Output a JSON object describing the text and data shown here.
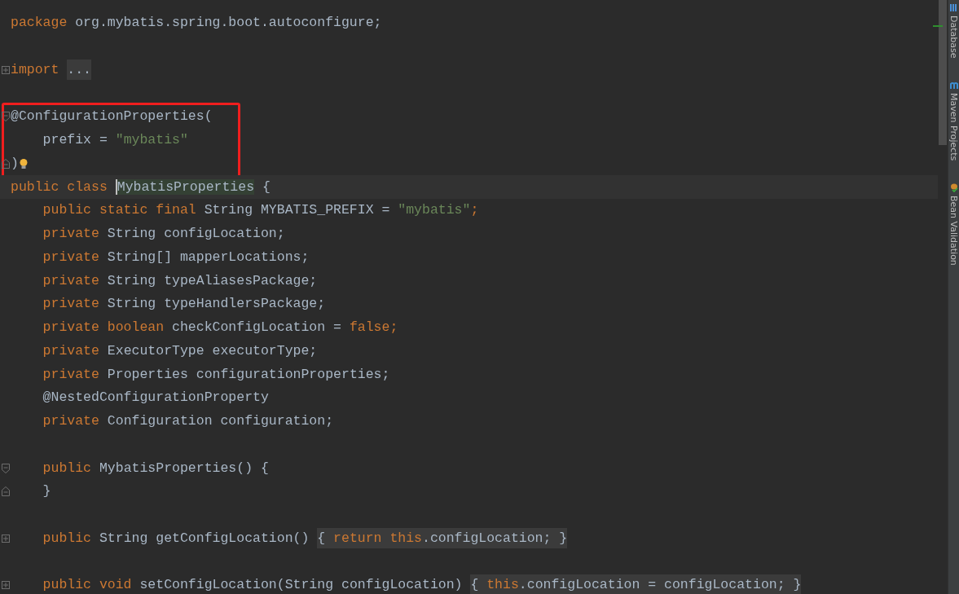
{
  "editor": {
    "lines": [
      {
        "tokens": [
          {
            "kind": "keyword",
            "text": "package"
          },
          {
            "kind": "plain",
            "text": " org.mybatis.spring.boot.autoconfigure;"
          }
        ]
      },
      {
        "blank_line_before": true,
        "gutter": {
          "kind": "collapsed"
        },
        "tokens": [
          {
            "kind": "keyword",
            "text": "import "
          },
          {
            "kind": "fold",
            "tokens": [
              {
                "kind": "plain",
                "text": "..."
              }
            ]
          }
        ]
      },
      {
        "blank_line_before": true,
        "gutter": {
          "kind": "start"
        },
        "boxed": true,
        "tokens": [
          {
            "kind": "plain",
            "text": "@ConfigurationProperties("
          }
        ]
      },
      {
        "boxed": true,
        "tokens": [
          {
            "kind": "plain",
            "text": "    prefix = "
          },
          {
            "kind": "string",
            "text": "\"mybatis\""
          }
        ]
      },
      {
        "gutter": {
          "kind": "end"
        },
        "boxed": true,
        "bulb": true,
        "tokens": [
          {
            "kind": "plain",
            "text": ")"
          }
        ]
      },
      {
        "current": true,
        "tokens": [
          {
            "kind": "keyword",
            "text": "public class "
          },
          {
            "kind": "usage",
            "text": "MybatisProperties"
          },
          {
            "kind": "plain",
            "text": " {"
          }
        ]
      },
      {
        "tokens": [
          {
            "kind": "keyword",
            "text": "    public static final "
          },
          {
            "kind": "plain",
            "text": "String MYBATIS_PREFIX = "
          },
          {
            "kind": "string",
            "text": "\"mybatis\""
          },
          {
            "kind": "keyword",
            "text": ";"
          }
        ]
      },
      {
        "tokens": [
          {
            "kind": "keyword",
            "text": "    private "
          },
          {
            "kind": "plain",
            "text": "String configLocation;"
          }
        ]
      },
      {
        "tokens": [
          {
            "kind": "keyword",
            "text": "    private "
          },
          {
            "kind": "plain",
            "text": "String[] mapperLocations;"
          }
        ]
      },
      {
        "tokens": [
          {
            "kind": "keyword",
            "text": "    private "
          },
          {
            "kind": "plain",
            "text": "String typeAliasesPackage;"
          }
        ]
      },
      {
        "tokens": [
          {
            "kind": "keyword",
            "text": "    private "
          },
          {
            "kind": "plain",
            "text": "String typeHandlersPackage;"
          }
        ]
      },
      {
        "tokens": [
          {
            "kind": "keyword",
            "text": "    private boolean "
          },
          {
            "kind": "plain",
            "text": "checkConfigLocation = "
          },
          {
            "kind": "keyword",
            "text": "false;"
          }
        ]
      },
      {
        "tokens": [
          {
            "kind": "keyword",
            "text": "    private "
          },
          {
            "kind": "plain",
            "text": "ExecutorType executorType;"
          }
        ]
      },
      {
        "tokens": [
          {
            "kind": "keyword",
            "text": "    private "
          },
          {
            "kind": "plain",
            "text": "Properties configurationProperties;"
          }
        ]
      },
      {
        "tokens": [
          {
            "kind": "plain",
            "text": "    @NestedConfigurationProperty"
          }
        ]
      },
      {
        "tokens": [
          {
            "kind": "keyword",
            "text": "    private "
          },
          {
            "kind": "plain",
            "text": "Configuration configuration;"
          }
        ]
      },
      {
        "blank_line_before": true,
        "gutter": {
          "kind": "start"
        },
        "tokens": [
          {
            "kind": "keyword",
            "text": "    public "
          },
          {
            "kind": "plain",
            "text": "MybatisProperties() {"
          }
        ]
      },
      {
        "gutter": {
          "kind": "end"
        },
        "tokens": [
          {
            "kind": "plain",
            "text": "    }"
          }
        ]
      },
      {
        "blank_line_before": true,
        "gutter": {
          "kind": "collapsed"
        },
        "tokens": [
          {
            "kind": "keyword",
            "text": "    public "
          },
          {
            "kind": "plain",
            "text": "String getConfigLocation() "
          },
          {
            "kind": "fold",
            "tokens": [
              {
                "kind": "plain",
                "text": "{ "
              },
              {
                "kind": "keyword",
                "text": "return this"
              },
              {
                "kind": "plain",
                "text": ".configLocation; }"
              }
            ]
          }
        ]
      },
      {
        "blank_line_before": true,
        "gutter": {
          "kind": "collapsed"
        },
        "tokens": [
          {
            "kind": "keyword",
            "text": "    public void "
          },
          {
            "kind": "plain",
            "text": "setConfigLocation(String configLocation) "
          },
          {
            "kind": "fold",
            "tokens": [
              {
                "kind": "plain",
                "text": "{ "
              },
              {
                "kind": "keyword",
                "text": "this"
              },
              {
                "kind": "plain",
                "text": ".configLocation = configLocation; }"
              }
            ]
          }
        ]
      }
    ]
  },
  "tool_windows": [
    {
      "label": "Database",
      "kind": "database"
    },
    {
      "label": "Maven Projects",
      "kind": "maven"
    },
    {
      "label": "Bean Validation",
      "kind": "bean"
    }
  ]
}
